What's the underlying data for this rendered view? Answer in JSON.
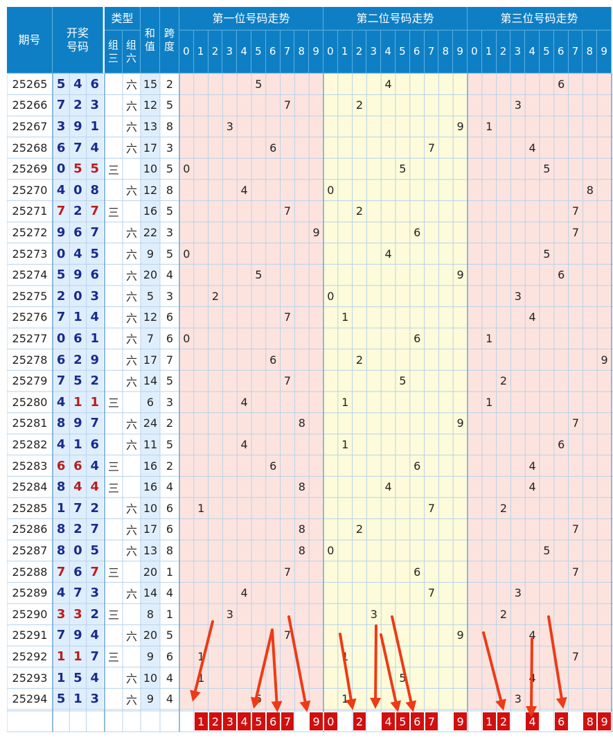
{
  "headers": {
    "issue": "期号",
    "draw": "开奖号码",
    "type": "类型",
    "type_z3": "组三",
    "type_z6": "组六",
    "sum": "和值",
    "span": "跨度",
    "pos1": "第一位号码走势",
    "pos2": "第二位号码走势",
    "pos3": "第三位号码走势",
    "digits": [
      "0",
      "1",
      "2",
      "3",
      "4",
      "5",
      "6",
      "7",
      "8",
      "9"
    ]
  },
  "chart_data": {
    "type": "table",
    "rows": [
      {
        "issue": "25265",
        "d": [
          "5",
          "4",
          "6"
        ],
        "type": "六",
        "sum": "15",
        "span": "2"
      },
      {
        "issue": "25266",
        "d": [
          "7",
          "2",
          "3"
        ],
        "type": "六",
        "sum": "12",
        "span": "5"
      },
      {
        "issue": "25267",
        "d": [
          "3",
          "9",
          "1"
        ],
        "type": "六",
        "sum": "13",
        "span": "8"
      },
      {
        "issue": "25268",
        "d": [
          "6",
          "7",
          "4"
        ],
        "type": "六",
        "sum": "17",
        "span": "3"
      },
      {
        "issue": "25269",
        "d": [
          "0",
          "5",
          "5"
        ],
        "type": "三",
        "sum": "10",
        "span": "5"
      },
      {
        "issue": "25270",
        "d": [
          "4",
          "0",
          "8"
        ],
        "type": "六",
        "sum": "12",
        "span": "8"
      },
      {
        "issue": "25271",
        "d": [
          "7",
          "2",
          "7"
        ],
        "type": "三",
        "sum": "16",
        "span": "5"
      },
      {
        "issue": "25272",
        "d": [
          "9",
          "6",
          "7"
        ],
        "type": "六",
        "sum": "22",
        "span": "3"
      },
      {
        "issue": "25273",
        "d": [
          "0",
          "4",
          "5"
        ],
        "type": "六",
        "sum": "9",
        "span": "5"
      },
      {
        "issue": "25274",
        "d": [
          "5",
          "9",
          "6"
        ],
        "type": "六",
        "sum": "20",
        "span": "4"
      },
      {
        "issue": "25275",
        "d": [
          "2",
          "0",
          "3"
        ],
        "type": "六",
        "sum": "5",
        "span": "3"
      },
      {
        "issue": "25276",
        "d": [
          "7",
          "1",
          "4"
        ],
        "type": "六",
        "sum": "12",
        "span": "6"
      },
      {
        "issue": "25277",
        "d": [
          "0",
          "6",
          "1"
        ],
        "type": "六",
        "sum": "7",
        "span": "6"
      },
      {
        "issue": "25278",
        "d": [
          "6",
          "2",
          "9"
        ],
        "type": "六",
        "sum": "17",
        "span": "7"
      },
      {
        "issue": "25279",
        "d": [
          "7",
          "5",
          "2"
        ],
        "type": "六",
        "sum": "14",
        "span": "5"
      },
      {
        "issue": "25280",
        "d": [
          "4",
          "1",
          "1"
        ],
        "type": "三",
        "sum": "6",
        "span": "3"
      },
      {
        "issue": "25281",
        "d": [
          "8",
          "9",
          "7"
        ],
        "type": "六",
        "sum": "24",
        "span": "2"
      },
      {
        "issue": "25282",
        "d": [
          "4",
          "1",
          "6"
        ],
        "type": "六",
        "sum": "11",
        "span": "5"
      },
      {
        "issue": "25283",
        "d": [
          "6",
          "6",
          "4"
        ],
        "type": "三",
        "sum": "16",
        "span": "2"
      },
      {
        "issue": "25284",
        "d": [
          "8",
          "4",
          "4"
        ],
        "type": "三",
        "sum": "16",
        "span": "4"
      },
      {
        "issue": "25285",
        "d": [
          "1",
          "7",
          "2"
        ],
        "type": "六",
        "sum": "10",
        "span": "6"
      },
      {
        "issue": "25286",
        "d": [
          "8",
          "2",
          "7"
        ],
        "type": "六",
        "sum": "17",
        "span": "6"
      },
      {
        "issue": "25287",
        "d": [
          "8",
          "0",
          "5"
        ],
        "type": "六",
        "sum": "13",
        "span": "8"
      },
      {
        "issue": "25288",
        "d": [
          "7",
          "6",
          "7"
        ],
        "type": "三",
        "sum": "20",
        "span": "1"
      },
      {
        "issue": "25289",
        "d": [
          "4",
          "7",
          "3"
        ],
        "type": "六",
        "sum": "14",
        "span": "4"
      },
      {
        "issue": "25290",
        "d": [
          "3",
          "3",
          "2"
        ],
        "type": "三",
        "sum": "8",
        "span": "1"
      },
      {
        "issue": "25291",
        "d": [
          "7",
          "9",
          "4"
        ],
        "type": "六",
        "sum": "20",
        "span": "5"
      },
      {
        "issue": "25292",
        "d": [
          "1",
          "1",
          "7"
        ],
        "type": "三",
        "sum": "9",
        "span": "6"
      },
      {
        "issue": "25293",
        "d": [
          "1",
          "5",
          "4"
        ],
        "type": "六",
        "sum": "10",
        "span": "4"
      },
      {
        "issue": "25294",
        "d": [
          "5",
          "1",
          "3"
        ],
        "type": "六",
        "sum": "9",
        "span": "4"
      }
    ],
    "picks": {
      "pos1": [
        "1",
        "2",
        "3",
        "4",
        "5",
        "6",
        "7",
        "9"
      ],
      "pos2": [
        "0",
        "2",
        "4",
        "5",
        "6",
        "7",
        "9"
      ],
      "pos3": [
        "1",
        "2",
        "4",
        "6",
        "8",
        "9"
      ]
    }
  },
  "colors": {
    "header": "#0e7fc4",
    "pos_bg_1": "#fde3de",
    "pos_bg_2": "#fdfbd9",
    "pick_bg": "#d10f0f",
    "arrow": "#ee3a16",
    "draw_text": "#1a2a8a",
    "repeat_text": "#b81d1d"
  }
}
